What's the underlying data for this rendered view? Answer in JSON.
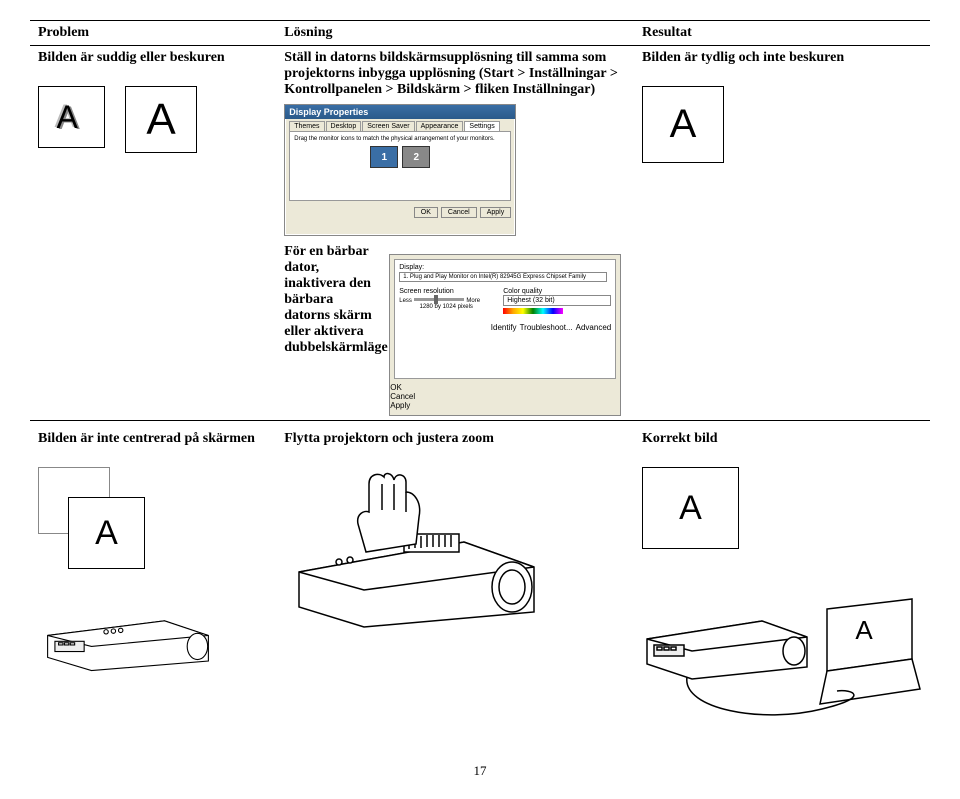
{
  "headers": {
    "problem": "Problem",
    "losning": "Lösning",
    "resultat": "Resultat"
  },
  "row1": {
    "problem": "Bilden är suddig eller beskuren",
    "losning": "Ställ in datorns bildskärmsupplösning till samma som projektorns inbygga upplösning (Start > Inställningar > Kontrollpanelen > Bildskärm > fliken Inställningar)",
    "resultat": "Bilden är tydlig och inte beskuren",
    "dialog_title": "Display Properties",
    "tabs": [
      "Themes",
      "Desktop",
      "Screen Saver",
      "Appearance",
      "Settings"
    ],
    "drag_text": "Drag the monitor icons to match the physical arrangement of your monitors.",
    "mon1": "1",
    "mon2": "2",
    "display_label": "Display:",
    "display_value": "1. Plug and Play Monitor on Intel(R) 82945G Express Chipset Family",
    "res_label": "Screen resolution",
    "res_value": "1280 by 1024 pixels",
    "res_less": "Less",
    "res_more": "More",
    "quality_label": "Color quality",
    "quality_value": "Highest (32 bit)",
    "btn_identify": "Identify",
    "btn_troubleshoot": "Troubleshoot...",
    "btn_advanced": "Advanced",
    "btn_ok": "OK",
    "btn_cancel": "Cancel",
    "btn_apply": "Apply"
  },
  "row2": {
    "note": "För en bärbar dator, inaktivera den bärbara datorns skärm eller aktivera dubbelskärmläge"
  },
  "row3": {
    "problem": "Bilden är inte centrerad på skärmen",
    "losning": "Flytta projektorn och justera zoom",
    "resultat": "Korrekt bild"
  },
  "letters": {
    "A": "A"
  },
  "page": "17"
}
